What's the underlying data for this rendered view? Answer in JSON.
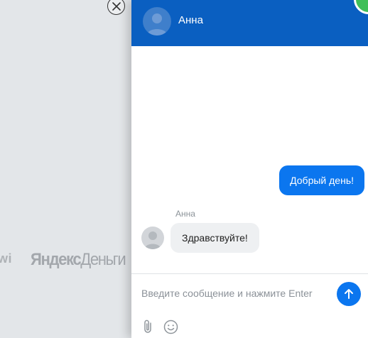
{
  "background": {
    "logos": {
      "qiwi": "wi",
      "yandex_bold": "Яндекс",
      "yandex_light": "Деньги"
    }
  },
  "overlay": {
    "close_icon": "close-icon"
  },
  "chat": {
    "header": {
      "contact_name": "Анна",
      "accent_color": "#0a5fc1",
      "status_color": "#3fbf58"
    },
    "messages": [
      {
        "direction": "outgoing",
        "text": "Добрый день!"
      },
      {
        "direction": "incoming",
        "sender": "Анна",
        "text": "Здравствуйте!"
      }
    ],
    "composer": {
      "placeholder": "Введите сообщение и нажмите Enter",
      "value": "",
      "send_icon": "arrow-up-icon",
      "attach_icon": "paperclip-icon",
      "emoji_icon": "smiley-icon"
    }
  }
}
